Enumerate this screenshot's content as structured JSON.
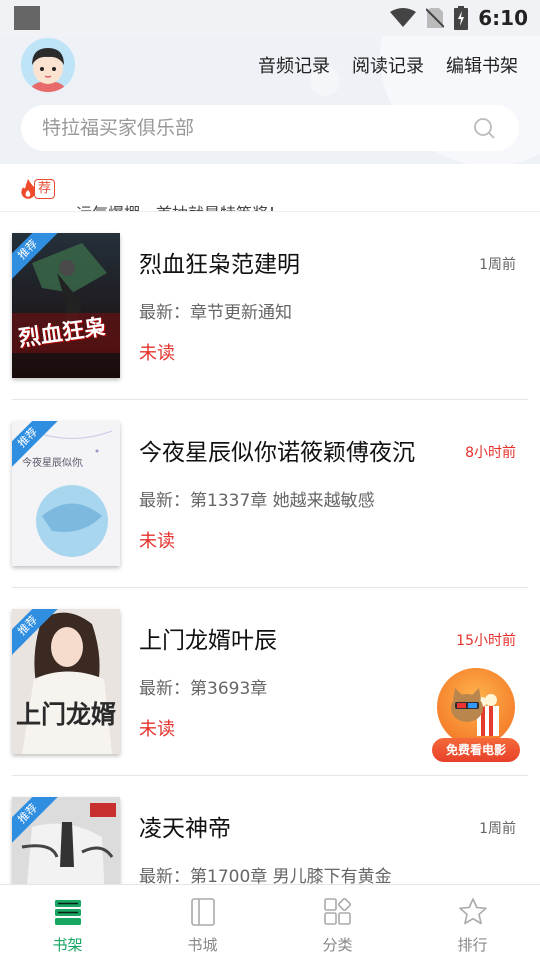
{
  "status_bar": {
    "time": "6:10"
  },
  "header": {
    "links": [
      "音频记录",
      "阅读记录",
      "编辑书架"
    ],
    "search": {
      "placeholder": "特拉福买家俱乐部"
    }
  },
  "notice": {
    "tag": "荐",
    "text": "运气爆棚，首抽就是特等奖！"
  },
  "books": [
    {
      "title": "烈血狂枭范建明",
      "time": "1周前",
      "time_red": false,
      "latest": "最新：章节更新通知",
      "status": "未读",
      "ribbon": "推荐",
      "cover_text": "烈血狂枭"
    },
    {
      "title": "今夜星辰似你诺筱颖傅夜沉",
      "time": "8小时前",
      "time_red": true,
      "latest": "最新：第1337章 她越来越敏感",
      "status": "未读",
      "ribbon": "推荐",
      "cover_text": "今夜星辰似你"
    },
    {
      "title": "上门龙婿叶辰",
      "time": "15小时前",
      "time_red": true,
      "latest": "最新：第3693章",
      "status": "未读",
      "ribbon": "推荐",
      "cover_text": "上门龙婿"
    },
    {
      "title": "凌天神帝",
      "time": "1周前",
      "time_red": false,
      "latest": "最新：第1700章 男儿膝下有黄金",
      "status": "",
      "ribbon": "推荐",
      "cover_text": ""
    }
  ],
  "float_ad": {
    "label": "免费看电影"
  },
  "bottom_nav": [
    {
      "label": "书架",
      "icon": "bookshelf-icon",
      "active": true
    },
    {
      "label": "书城",
      "icon": "book-icon",
      "active": false
    },
    {
      "label": "分类",
      "icon": "category-icon",
      "active": false
    },
    {
      "label": "排行",
      "icon": "star-icon",
      "active": false
    }
  ],
  "colors": {
    "accent": "#19a562",
    "unread": "#e5322d",
    "ribbon": "#2f8ee0"
  }
}
